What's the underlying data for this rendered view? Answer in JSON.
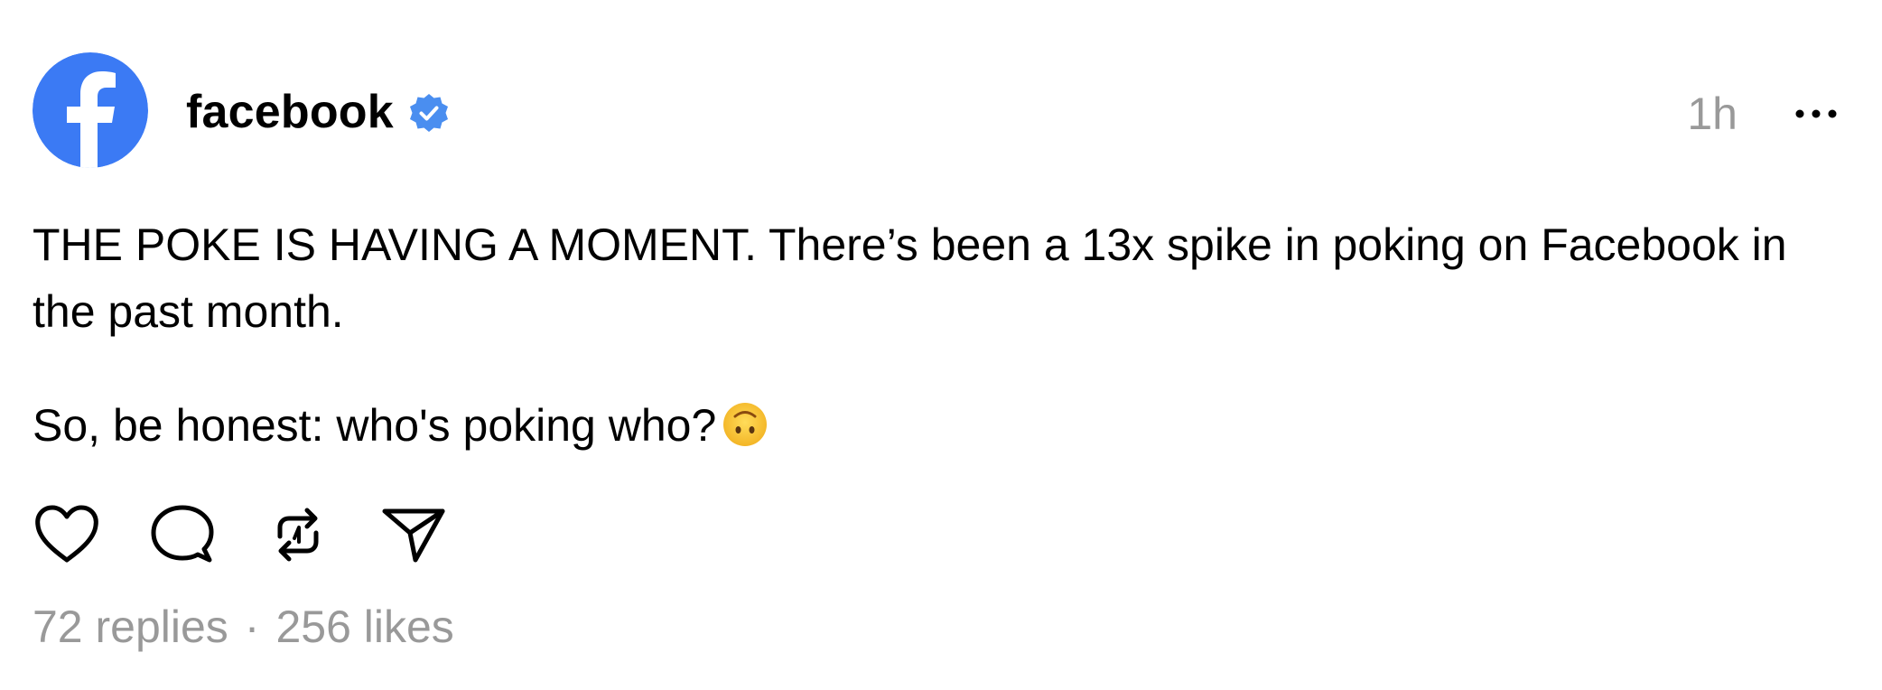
{
  "post": {
    "author": {
      "name": "facebook",
      "verified": true,
      "avatar_icon": "facebook-logo-icon",
      "avatar_color": "#3b82f6"
    },
    "timestamp": "1h",
    "more_icon": "more-options-icon",
    "body": {
      "paragraph_1": "THE POKE IS HAVING A MOMENT. There’s been a 13x spike in poking on Facebook in the past month.",
      "paragraph_2": "So, be honest: who's poking who?",
      "paragraph_2_emoji": "upside-down-face-emoji"
    },
    "actions": [
      {
        "icon": "heart-icon",
        "label": "Like"
      },
      {
        "icon": "comment-icon",
        "label": "Reply"
      },
      {
        "icon": "repost-icon",
        "label": "Repost"
      },
      {
        "icon": "share-icon",
        "label": "Share"
      }
    ],
    "stats": {
      "replies": "72 replies",
      "separator": "·",
      "likes": "256 likes"
    },
    "colors": {
      "verified_badge": "#4a8ef0",
      "muted_text": "#999999"
    }
  }
}
